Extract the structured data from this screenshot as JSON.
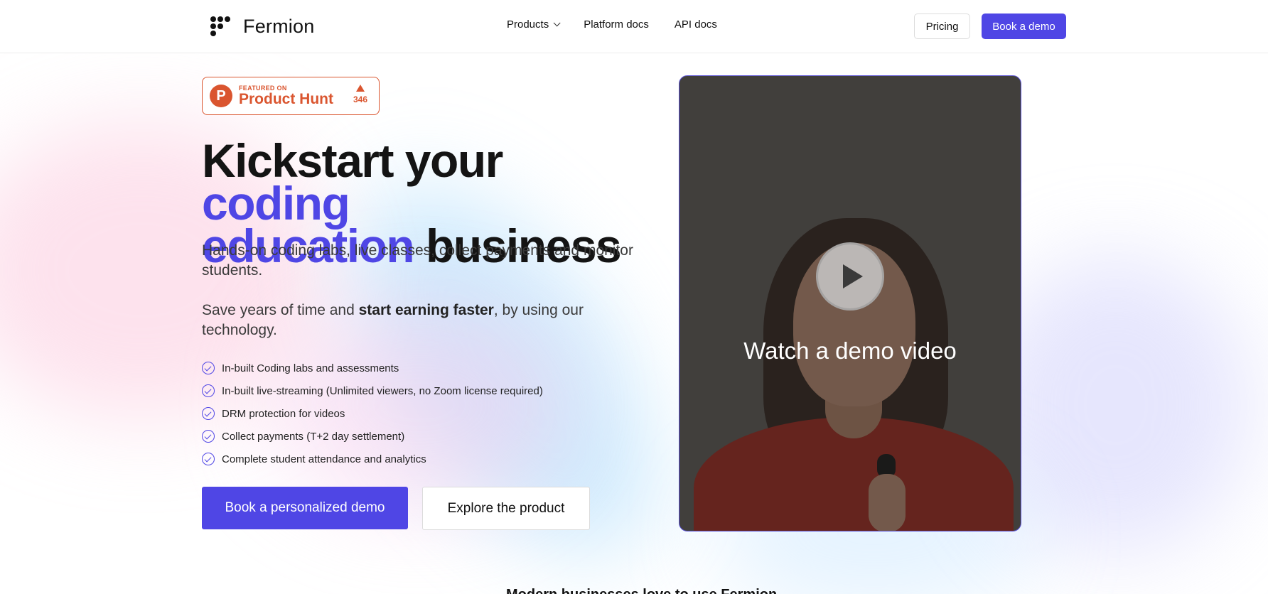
{
  "header": {
    "brand": "Fermion",
    "nav": [
      {
        "label": "Products",
        "has_dropdown": true
      },
      {
        "label": "Platform docs",
        "has_dropdown": false
      },
      {
        "label": "API docs",
        "has_dropdown": false
      }
    ],
    "pricing_label": "Pricing",
    "book_demo_label": "Book a demo",
    "accent_color": "#4f46e5"
  },
  "product_hunt": {
    "featured_label": "FEATURED ON",
    "name": "Product Hunt",
    "logo_letter": "P",
    "upvotes": "346"
  },
  "hero": {
    "title_part1": "Kickstart your ",
    "title_accent1": "coding",
    "title_accent2": "education",
    "title_part2": " business",
    "subtitle": "Hands-on coding labs, live classes, collect payments and monitor students.",
    "subtitle2_pre": "Save years of time and ",
    "subtitle2_bold": "start earning faster",
    "subtitle2_post": ", by using our technology.",
    "features": [
      "In-built Coding labs and assessments",
      "In-built live-streaming (Unlimited viewers, no Zoom license required)",
      "DRM protection for videos",
      "Collect payments (T+2 day settlement)",
      "Complete student attendance and analytics"
    ],
    "primary_cta": "Book a personalized demo",
    "secondary_cta": "Explore the product"
  },
  "video": {
    "label": "Watch a demo video"
  },
  "bottom_peek": "Modern businesses love to use Fermion"
}
